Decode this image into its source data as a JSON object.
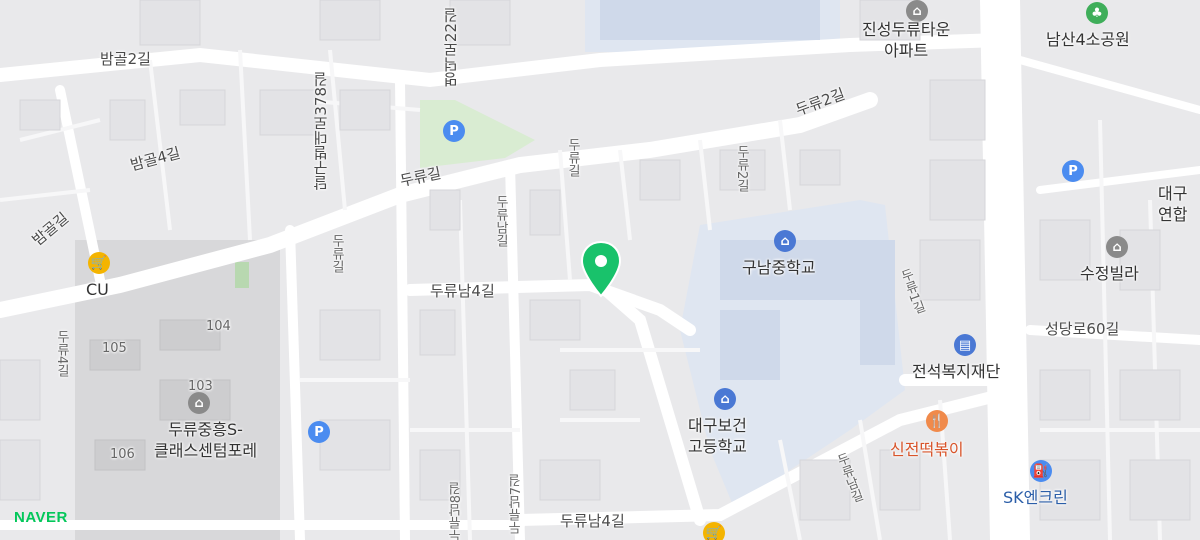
{
  "brand": "NAVER",
  "marker": {
    "name": "location-pin"
  },
  "roads": {
    "bamgol2": "밤골2길",
    "bamgol4": "밤골4길",
    "bamgol": "밤골길",
    "myeongdeok22": "명덕로22길",
    "dalgubeol378": "달구벌대로378길",
    "duryu_gil": "두류길",
    "duryu2": "두류2길",
    "duryu2_v": "두류2길",
    "duryu_gil_v": "두류길",
    "duryunam": "두류남길",
    "duryunam4": "두류남4길",
    "duryunam4_b": "두류남4길",
    "duryu1": "두류1길",
    "duryu4": "두류4길",
    "duryu_left": "두류길",
    "seongdang60": "성당로60길",
    "duryunam8": "두류남8길",
    "duryunam7": "두류남7길",
    "duryunam_right": "두류남길"
  },
  "pois": {
    "jinseong": [
      "진성두류타운",
      "아파트"
    ],
    "namsan_park": "남산4소공원",
    "cu": "CU",
    "gunam_ms": "구남중학교",
    "daegu_health_hs": [
      "대구보건",
      "고등학교"
    ],
    "jeonseok": "전석복지재단",
    "sinjeon": "신전떡볶이",
    "sk": "SK엔크린",
    "sujeong": "수정빌라",
    "daegu_yeonhap": [
      "대구",
      "연합"
    ],
    "duryu_classcenter": [
      "두류중흥S-",
      "클래스센텀포레"
    ]
  },
  "building_numbers": {
    "b104": "104",
    "b105": "105",
    "b103": "103",
    "b106": "106"
  },
  "icons": {
    "parking": "P",
    "colors": {
      "parking": "#4b8cf0",
      "school": "#4a78d4",
      "food": "#f08a4b",
      "gas": "#4b8cf0",
      "pin": "#19c26b",
      "park": "#3fae5a",
      "store": "#f4b400"
    }
  }
}
